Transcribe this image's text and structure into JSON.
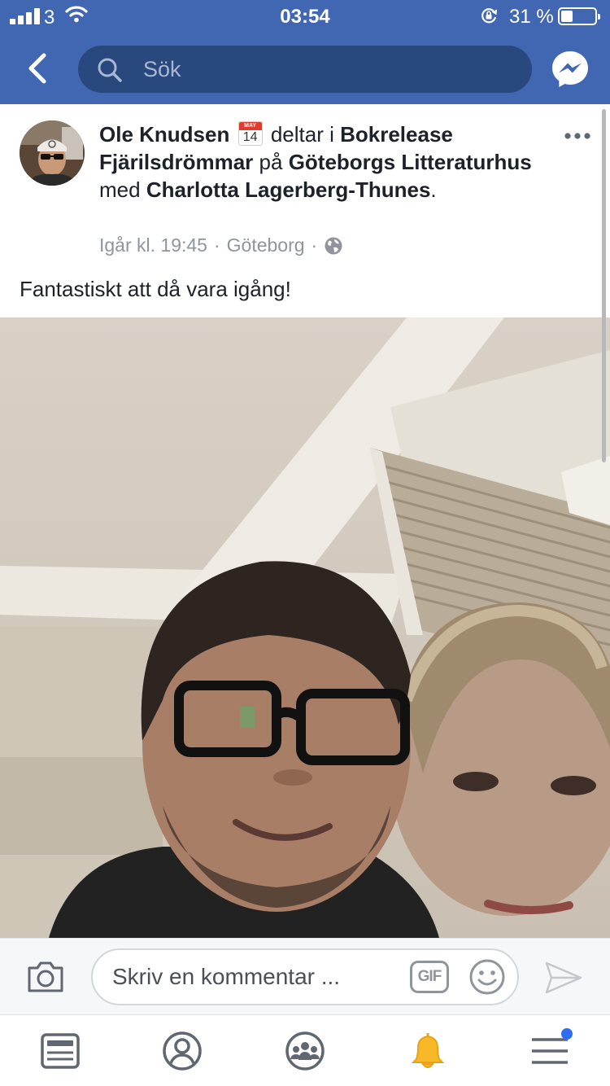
{
  "status_bar": {
    "carrier": "3",
    "time": "03:54",
    "battery_percent_text": "31 %",
    "battery_level": 0.31
  },
  "nav": {
    "search_placeholder": "Sök",
    "back_icon": "chevron-left-icon",
    "messenger_icon": "messenger-icon"
  },
  "post": {
    "author": "Ole Knudsen",
    "calendar_month": "MAY",
    "calendar_day": "14",
    "verb": "deltar i",
    "event": "Bokrelease Fjärilsdrömmar",
    "prep_at": "på",
    "venue": "Göteborgs Litteraturhus",
    "prep_with": "med",
    "tagged": "Charlotta Lagerberg-Thunes",
    "period": ".",
    "timestamp": "Igår kl. 19:45",
    "separator": "·",
    "location": "Göteborg",
    "privacy_icon": "globe-icon",
    "text": "Fantastiskt att då vara igång!"
  },
  "comment": {
    "placeholder": "Skriv en kommentar ...",
    "gif_label": "GIF"
  },
  "colors": {
    "brand": "#4267b2",
    "search_bg": "#29487d",
    "notification": "#f7b928",
    "badge": "#2e6ff2"
  },
  "tabs": [
    {
      "name": "news-feed",
      "icon": "feed-icon"
    },
    {
      "name": "profile",
      "icon": "profile-icon"
    },
    {
      "name": "groups",
      "icon": "groups-icon"
    },
    {
      "name": "notifications",
      "icon": "bell-icon"
    },
    {
      "name": "menu",
      "icon": "hamburger-icon"
    }
  ]
}
